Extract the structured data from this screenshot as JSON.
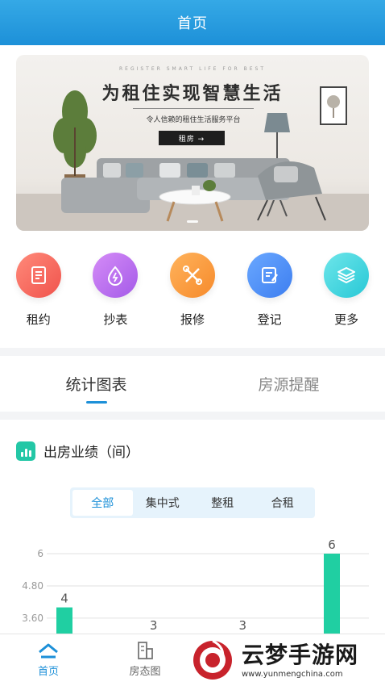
{
  "header": {
    "title": "首页"
  },
  "banner": {
    "small_text": "REGISTER SMART LIFE FOR BEST",
    "title": "为租住实现智慧生活",
    "subtitle": "令人信赖的租住生活服务平台",
    "button_label": "租房 →"
  },
  "menu": {
    "items": [
      {
        "label": "租约",
        "icon": "contract-icon",
        "color_from": "#ff8a7a",
        "color_to": "#f0534c"
      },
      {
        "label": "抄表",
        "icon": "meter-icon",
        "color_from": "#d58cf7",
        "color_to": "#a45ae8"
      },
      {
        "label": "报修",
        "icon": "repair-icon",
        "color_from": "#ffb35c",
        "color_to": "#f68a2b"
      },
      {
        "label": "登记",
        "icon": "register-icon",
        "color_from": "#6aa8ff",
        "color_to": "#3d7ef0"
      },
      {
        "label": "更多",
        "icon": "layers-icon",
        "color_from": "#6ee6ea",
        "color_to": "#27c8d6"
      }
    ]
  },
  "tabs": [
    {
      "label": "统计图表",
      "active": true
    },
    {
      "label": "房源提醒",
      "active": false
    }
  ],
  "stats": {
    "title": "出房业绩（间）",
    "segments": [
      {
        "label": "全部",
        "active": true
      },
      {
        "label": "集中式",
        "active": false
      },
      {
        "label": "整租",
        "active": false
      },
      {
        "label": "合租",
        "active": false
      }
    ]
  },
  "chart_data": {
    "type": "bar",
    "y_ticks": [
      "6",
      "4.80",
      "3.60"
    ],
    "values": [
      4,
      3,
      3,
      6
    ],
    "bar_color": "#20cfa2",
    "ylim": [
      0,
      6
    ]
  },
  "bottom_nav": [
    {
      "label": "首页",
      "active": true
    },
    {
      "label": "房态图",
      "active": false
    }
  ],
  "watermark": {
    "text": "云梦手游网",
    "url": "www.yunmengchina.com"
  }
}
